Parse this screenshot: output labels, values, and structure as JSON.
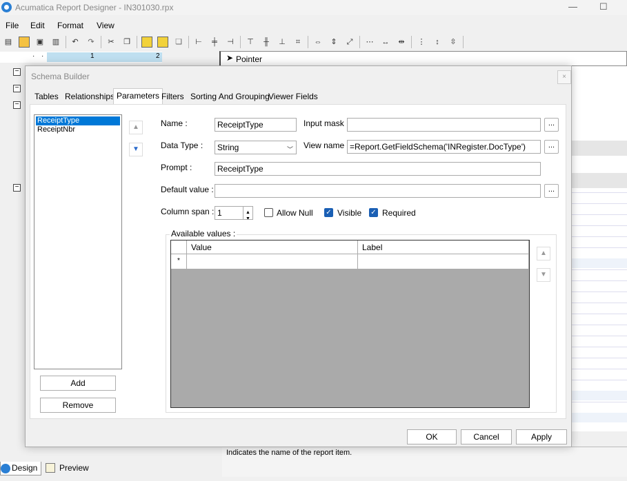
{
  "window": {
    "title": "Acumatica Report Designer - IN301030.rpx",
    "minimize": "—",
    "maximize": "☐"
  },
  "menu": [
    "File",
    "Edit",
    "Format",
    "View"
  ],
  "ruler": {
    "mark1": "1",
    "mark2": "2"
  },
  "right_panel": {
    "pointer_label": "Pointer"
  },
  "description": "Indicates the name of the report item.",
  "bottom_tabs": {
    "design": "Design",
    "preview": "Preview"
  },
  "dialog": {
    "title": "Schema Builder",
    "close": "×",
    "tabs": [
      "Tables",
      "Relationships",
      "Parameters",
      "Filters",
      "Sorting And Grouping",
      "Viewer Fields"
    ],
    "selected_tab": "Parameters",
    "parameters": [
      "ReceiptType",
      "ReceiptNbr"
    ],
    "selected_parameter": "ReceiptType",
    "add_label": "Add",
    "remove_label": "Remove",
    "fields": {
      "name_label": "Name :",
      "name_value": "ReceiptType",
      "input_mask_label": "Input mask :",
      "input_mask_value": "",
      "data_type_label": "Data Type :",
      "data_type_value": "String",
      "view_name_label": "View name :",
      "view_name_value": "=Report.GetFieldSchema('INRegister.DocType')",
      "prompt_label": "Prompt :",
      "prompt_value": "ReceiptType",
      "default_value_label": "Default value :",
      "default_value_value": "",
      "column_span_label": "Column span :",
      "column_span_value": "1",
      "dots": "..."
    },
    "checks": {
      "allow_null": {
        "label": "Allow Null",
        "checked": false
      },
      "visible": {
        "label": "Visible",
        "checked": true
      },
      "required": {
        "label": "Required",
        "checked": true
      }
    },
    "available_values": {
      "label": "Available values :",
      "columns": [
        "Value",
        "Label"
      ],
      "new_row_marker": "*"
    },
    "ok_label": "OK",
    "cancel_label": "Cancel",
    "apply_label": "Apply"
  }
}
